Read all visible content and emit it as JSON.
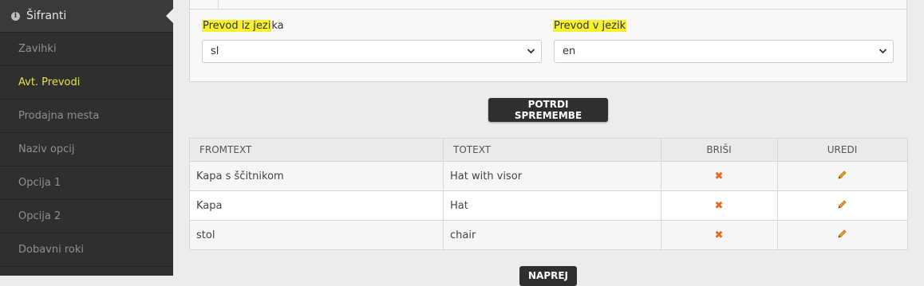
{
  "sidebar": {
    "header": "Šifranti",
    "items": [
      {
        "label": "Zavihki"
      },
      {
        "label": "Avt. Prevodi"
      },
      {
        "label": "Prodajna mesta"
      },
      {
        "label": "Naziv opcij"
      },
      {
        "label": "Opcija 1"
      },
      {
        "label": "Opcija 2"
      },
      {
        "label": "Dobavni roki"
      }
    ],
    "active_index": 1
  },
  "form": {
    "from_label_highlight": "Prevod iz jezi",
    "from_label_rest": "ka",
    "from_value": "sl",
    "to_label": "Prevod v jezik",
    "to_value": "en"
  },
  "actions": {
    "confirm_label": "POTRDI SPREMEMBE",
    "next_label": "NAPREJ"
  },
  "table": {
    "headers": [
      "FROMTEXT",
      "TOTEXT",
      "BRIŠI",
      "UREDI"
    ],
    "rows": [
      {
        "fromtext": "Kapa s ščitnikom",
        "totext": "Hat with visor"
      },
      {
        "fromtext": "Kapa",
        "totext": "Hat"
      },
      {
        "fromtext": "stol",
        "totext": "chair"
      }
    ]
  },
  "colors": {
    "sidebar_bg": "#2f2f2f",
    "active_text": "#e6e24a",
    "highlight": "#f6f12a",
    "delete_icon": "#e8681c",
    "edit_icon": "#f0a020"
  },
  "icons": {
    "header": "info-icon",
    "delete": "x-icon",
    "edit": "pencil-icon",
    "select": "chevron-down-icon"
  }
}
